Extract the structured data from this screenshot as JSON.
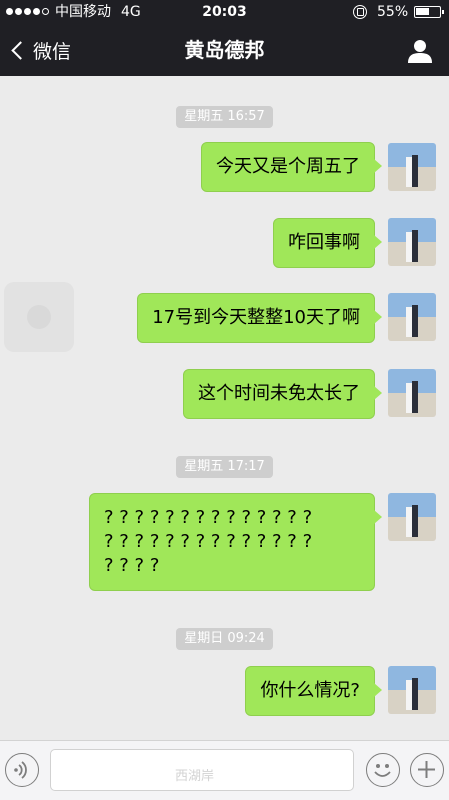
{
  "status_bar": {
    "carrier": "中国移动",
    "network": "4G",
    "time": "20:03",
    "battery": "55%"
  },
  "nav": {
    "back_label": "微信",
    "title": "黄岛德邦"
  },
  "chat": {
    "timestamps": [
      "星期五 16:57",
      "星期五 17:17",
      "星期日 09:24"
    ],
    "messages": [
      "今天又是个周五了",
      "咋回事啊",
      "17号到今天整整10天了啊",
      "这个时间未免太长了",
      "? ? ? ? ? ? ? ? ? ? ? ? ? ?\n? ? ? ? ? ? ? ? ? ? ? ? ? ?\n? ? ? ?",
      "你什么情况?"
    ]
  },
  "input_bar": {
    "watermark": "西湖岸"
  },
  "colors": {
    "header_bg": "#1f1f24",
    "chat_bg": "#ebebeb",
    "bubble_green": "#a0e759",
    "timestamp_bg": "#cecece"
  },
  "icons": [
    "back-chevron-icon",
    "profile-icon",
    "avatar-photo-icon",
    "voice-icon",
    "emoji-icon",
    "plus-icon",
    "lock-rotation-icon",
    "battery-icon",
    "signal-dots-icon"
  ]
}
